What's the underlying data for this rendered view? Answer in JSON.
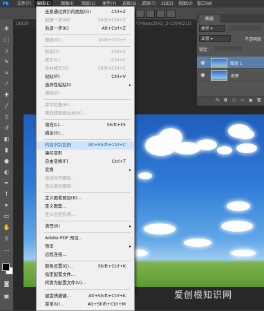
{
  "menubar": {
    "logo": "PS",
    "items": [
      "文件(F)",
      "编辑(E)",
      "图像(I)",
      "图层(L)",
      "类型(Y)",
      "选择(S)",
      "滤镜(T)",
      "3D(D)",
      "视图(V)",
      "窗口(W)"
    ],
    "active_index": 1
  },
  "document": {
    "tab_left": "18929",
    "tab_right": "8c7749eac3642_3-1304021U"
  },
  "edit_menu": {
    "items": [
      {
        "label": "还原通过拷贝的图层(O)",
        "shortcut": "Ctrl+Z",
        "enabled": true
      },
      {
        "label": "前进一步(W)",
        "shortcut": "Shift+Ctrl+Z",
        "enabled": false
      },
      {
        "label": "后退一步(K)",
        "shortcut": "Alt+Ctrl+Z",
        "enabled": true
      },
      {
        "label": "渐隐(D)...",
        "shortcut": "Shift+Ctrl+F",
        "enabled": false
      },
      {
        "label": "剪切(T)",
        "shortcut": "Ctrl+X",
        "enabled": false
      },
      {
        "label": "拷贝(C)",
        "shortcut": "Ctrl+C",
        "enabled": false
      },
      {
        "label": "合并拷贝(Y)",
        "shortcut": "Shift+Ctrl+C",
        "enabled": false
      },
      {
        "label": "粘贴(P)",
        "shortcut": "Ctrl+V",
        "enabled": true
      },
      {
        "label": "选择性粘贴(I)",
        "shortcut": "",
        "enabled": true,
        "submenu": true
      },
      {
        "label": "清除(E)",
        "shortcut": "",
        "enabled": false
      },
      {
        "label": "拼写检查(H)...",
        "shortcut": "",
        "enabled": false
      },
      {
        "label": "查找和替换文本(X)...",
        "shortcut": "",
        "enabled": false
      },
      {
        "label": "填充(L)...",
        "shortcut": "Shift+F5",
        "enabled": true
      },
      {
        "label": "描边(S)...",
        "shortcut": "",
        "enabled": true
      },
      {
        "label": "内容识别比例",
        "shortcut": "Alt+Shift+Ctrl+C",
        "enabled": true,
        "highlighted": true
      },
      {
        "label": "操控变形",
        "shortcut": "",
        "enabled": true
      },
      {
        "label": "自由变换(F)",
        "shortcut": "Ctrl+T",
        "enabled": true
      },
      {
        "label": "变换",
        "shortcut": "",
        "enabled": true,
        "submenu": true
      },
      {
        "label": "自动对齐图层...",
        "shortcut": "",
        "enabled": false
      },
      {
        "label": "自动混合图层...",
        "shortcut": "",
        "enabled": false
      },
      {
        "label": "定义画笔预设(B)...",
        "shortcut": "",
        "enabled": true
      },
      {
        "label": "定义图案...",
        "shortcut": "",
        "enabled": true
      },
      {
        "label": "定义自定形状...",
        "shortcut": "",
        "enabled": false
      },
      {
        "label": "清理(R)",
        "shortcut": "",
        "enabled": true,
        "submenu": true
      },
      {
        "label": "Adobe PDF 预设...",
        "shortcut": "",
        "enabled": true
      },
      {
        "label": "预设",
        "shortcut": "",
        "enabled": true,
        "submenu": true
      },
      {
        "label": "远程连接...",
        "shortcut": "",
        "enabled": true
      },
      {
        "label": "颜色设置(G)...",
        "shortcut": "Shift+Ctrl+K",
        "enabled": true
      },
      {
        "label": "指定配置文件...",
        "shortcut": "",
        "enabled": true
      },
      {
        "label": "转换为配置文件(V)...",
        "shortcut": "",
        "enabled": true
      },
      {
        "label": "键盘快捷键...",
        "shortcut": "Alt+Shift+Ctrl+K",
        "enabled": true
      },
      {
        "label": "菜单(U)...",
        "shortcut": "Alt+Shift+Ctrl+M",
        "enabled": true
      }
    ]
  },
  "layers_panel": {
    "tab_label": "图层",
    "filter_label": "类型",
    "blend_mode": "正常",
    "opacity_label": "不透明度",
    "lock_label": "锁定:",
    "layers": [
      {
        "name": "图层 1",
        "selected": true
      },
      {
        "name": "背景",
        "selected": false
      }
    ],
    "footer_icons": [
      "fx",
      "◘",
      "○",
      "▭",
      "▣",
      "🗑"
    ]
  },
  "watermark": "爱创根知识网"
}
